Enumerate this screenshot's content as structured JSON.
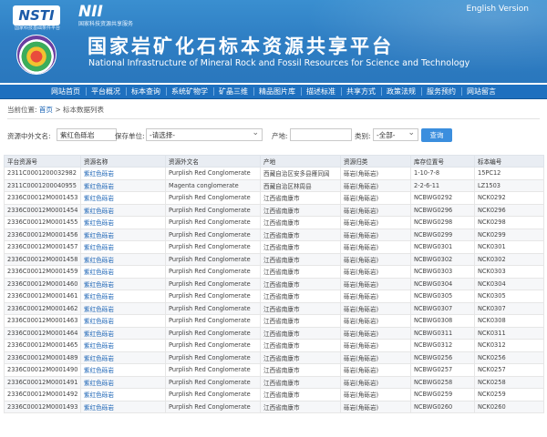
{
  "header": {
    "logo_left": "NSTI",
    "logo_left_sub": "国家科技基础条件平台",
    "logo_right": "NII",
    "logo_right_sub": "国家科技资源共享服务",
    "english_link": "English Version",
    "title_cn": "国家岩矿化石标本资源共享平台",
    "title_en": "National Infrastructure of Mineral Rock and Fossil Resources for Science and Technology"
  },
  "nav": {
    "items": [
      "网站首页",
      "平台概况",
      "标本查询",
      "系统矿物学",
      "矿晶三维",
      "精品图片库",
      "描述标准",
      "共享方式",
      "政策法规",
      "服务预约",
      "网站留言"
    ]
  },
  "breadcrumb": {
    "prefix": "当前位置:",
    "home": "首页",
    "current": "> 标本数据列表"
  },
  "filters": {
    "name_label": "资源中外文名:",
    "name_value": "紫红色砾岩",
    "unit_label": "保存单位:",
    "unit_value": "-请选择-",
    "origin_label": "产地:",
    "origin_value": "",
    "category_label": "类别:",
    "category_value": "-全部-",
    "query_button": "查询"
  },
  "table": {
    "headers": [
      "平台资源号",
      "资源名称",
      "资源外文名",
      "产地",
      "资源归类",
      "库存位置号",
      "标本编号"
    ],
    "rows": [
      [
        "2311C0001200032982",
        "紫红色砾岩",
        "Purplish Red Conglomerate",
        "西藏自治区安多县雁同阔",
        "砾岩(角砾岩)",
        "1-10-7-8",
        "15PC12"
      ],
      [
        "2311C0001200040955",
        "紫红色砾岩",
        "Magenta conglomerate",
        "西藏自治区林周县",
        "砾岩(角砾岩)",
        "2-2-6-11",
        "LZ1503"
      ],
      [
        "2336C00012M0001453",
        "紫红色砾岩",
        "Purplish Red Conglomerate",
        "江西省南康市",
        "砾岩(角砾岩)",
        "NCBWG0292",
        "NCK0292"
      ],
      [
        "2336C00012M0001454",
        "紫红色砾岩",
        "Purplish Red Conglomerate",
        "江西省南康市",
        "砾岩(角砾岩)",
        "NCBWG0296",
        "NCK0296"
      ],
      [
        "2336C00012M0001455",
        "紫红色砾岩",
        "Purplish Red Conglomerate",
        "江西省南康市",
        "砾岩(角砾岩)",
        "NCBWG0298",
        "NCK0298"
      ],
      [
        "2336C00012M0001456",
        "紫红色砾岩",
        "Purplish Red Conglomerate",
        "江西省南康市",
        "砾岩(角砾岩)",
        "NCBWG0299",
        "NCK0299"
      ],
      [
        "2336C00012M0001457",
        "紫红色砾岩",
        "Purplish Red Conglomerate",
        "江西省南康市",
        "砾岩(角砾岩)",
        "NCBWG0301",
        "NCK0301"
      ],
      [
        "2336C00012M0001458",
        "紫红色砾岩",
        "Purplish Red Conglomerate",
        "江西省南康市",
        "砾岩(角砾岩)",
        "NCBWG0302",
        "NCK0302"
      ],
      [
        "2336C00012M0001459",
        "紫红色砾岩",
        "Purplish Red Conglomerate",
        "江西省南康市",
        "砾岩(角砾岩)",
        "NCBWG0303",
        "NCK0303"
      ],
      [
        "2336C00012M0001460",
        "紫红色砾岩",
        "Purplish Red Conglomerate",
        "江西省南康市",
        "砾岩(角砾岩)",
        "NCBWG0304",
        "NCK0304"
      ],
      [
        "2336C00012M0001461",
        "紫红色砾岩",
        "Purplish Red Conglomerate",
        "江西省南康市",
        "砾岩(角砾岩)",
        "NCBWG0305",
        "NCK0305"
      ],
      [
        "2336C00012M0001462",
        "紫红色砾岩",
        "Purplish Red Conglomerate",
        "江西省南康市",
        "砾岩(角砾岩)",
        "NCBWG0307",
        "NCK0307"
      ],
      [
        "2336C00012M0001463",
        "紫红色砾岩",
        "Purplish Red Conglomerate",
        "江西省南康市",
        "砾岩(角砾岩)",
        "NCBWG0308",
        "NCK0308"
      ],
      [
        "2336C00012M0001464",
        "紫红色砾岩",
        "Purplish Red Conglomerate",
        "江西省南康市",
        "砾岩(角砾岩)",
        "NCBWG0311",
        "NCK0311"
      ],
      [
        "2336C00012M0001465",
        "紫红色砾岩",
        "Purplish Red Conglomerate",
        "江西省南康市",
        "砾岩(角砾岩)",
        "NCBWG0312",
        "NCK0312"
      ],
      [
        "2336C00012M0001489",
        "紫红色砾岩",
        "Purplish Red Conglomerate",
        "江西省南康市",
        "砾岩(角砾岩)",
        "NCBWG0256",
        "NCK0256"
      ],
      [
        "2336C00012M0001490",
        "紫红色砾岩",
        "Purplish Red Conglomerate",
        "江西省南康市",
        "砾岩(角砾岩)",
        "NCBWG0257",
        "NCK0257"
      ],
      [
        "2336C00012M0001491",
        "紫红色砾岩",
        "Purplish Red Conglomerate",
        "江西省南康市",
        "砾岩(角砾岩)",
        "NCBWG0258",
        "NCK0258"
      ],
      [
        "2336C00012M0001492",
        "紫红色砾岩",
        "Purplish Red Conglomerate",
        "江西省南康市",
        "砾岩(角砾岩)",
        "NCBWG0259",
        "NCK0259"
      ],
      [
        "2336C00012M0001493",
        "紫红色砾岩",
        "Purplish Red Conglomerate",
        "江西省南康市",
        "砾岩(角砾岩)",
        "NCBWG0260",
        "NCK0260"
      ]
    ]
  },
  "colors": {
    "banner": "#2f7fc4",
    "nav": "#1e70bf",
    "link": "#1a63b5",
    "button": "#3b8ede",
    "table_header": "#e9edf3"
  }
}
